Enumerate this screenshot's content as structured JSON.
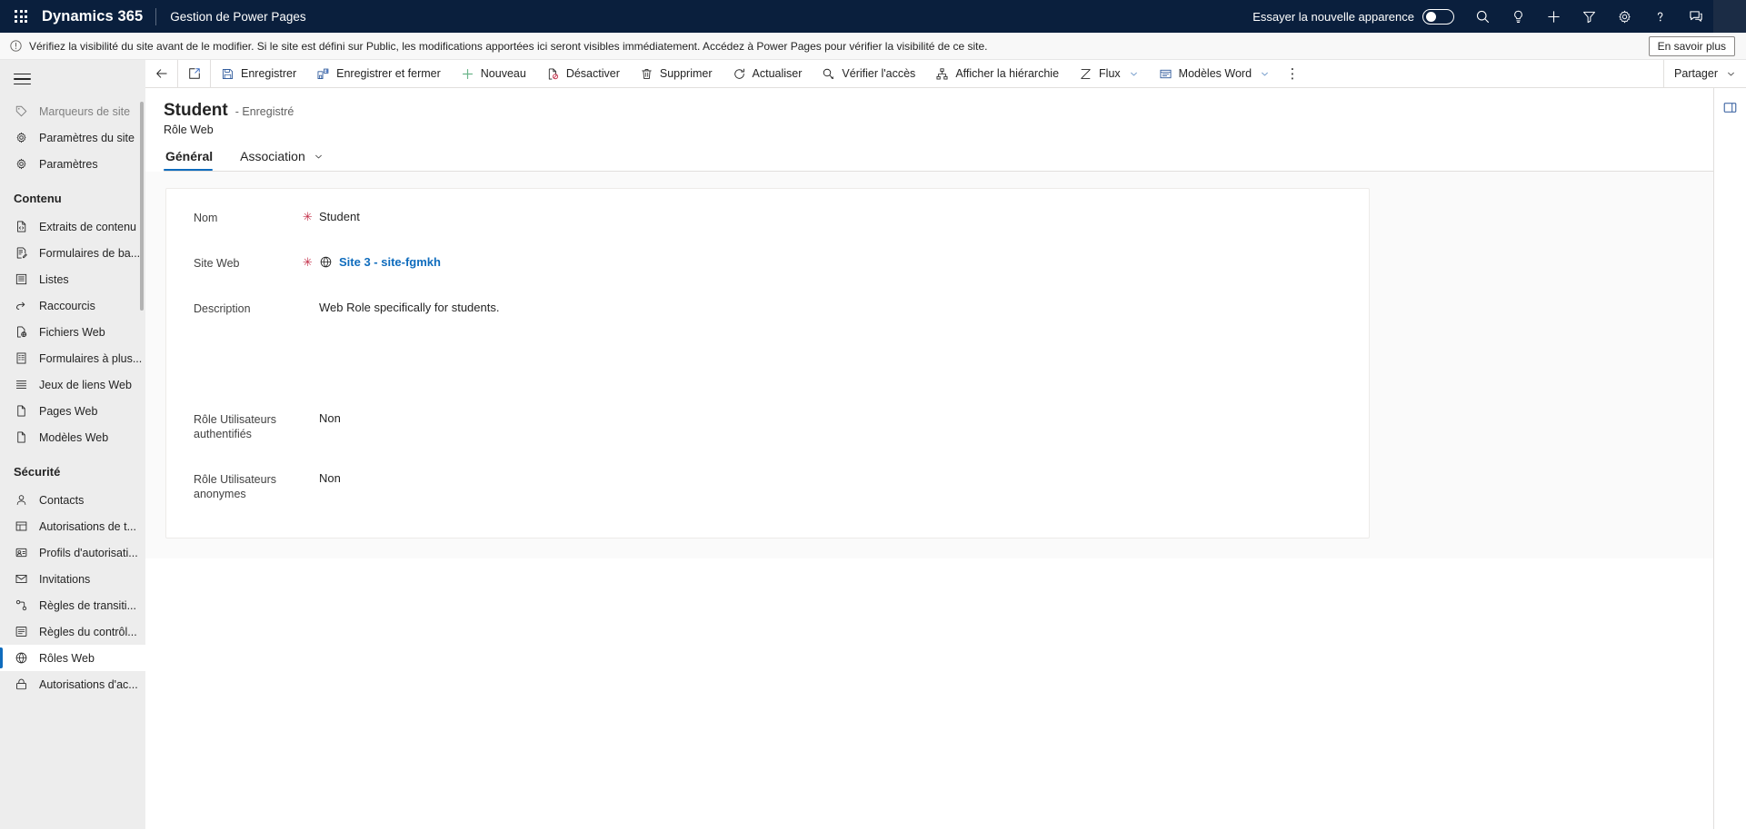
{
  "header": {
    "waffle_label": "waffle-icon",
    "brand": "Dynamics 365",
    "app_name": "Gestion de Power Pages",
    "new_look_label": "Essayer la nouvelle apparence",
    "new_look_enabled": false,
    "icons": [
      "search-icon",
      "lightbulb-icon",
      "plus-icon",
      "filter-icon",
      "gear-icon",
      "help-icon",
      "feedback-icon"
    ],
    "background": "#0a1f3d"
  },
  "banner": {
    "icon": "info-icon",
    "text": "Vérifiez la visibilité du site avant de le modifier. Si le site est défini sur Public, les modifications apportées ici seront visibles immédiatement. Accédez à Power Pages pour vérifier la visibilité de ce site.",
    "button_label": "En savoir plus"
  },
  "sidebar": {
    "hamburger": "hamburger-icon",
    "items_top": [
      {
        "label": "Marqueurs de site",
        "icon": "tag-icon",
        "partial": true
      },
      {
        "label": "Paramètres du site",
        "icon": "gear-site-icon"
      },
      {
        "label": "Paramètres",
        "icon": "gear-icon"
      }
    ],
    "groups": [
      {
        "title": "Contenu",
        "items": [
          {
            "label": "Extraits de contenu",
            "icon": "code-file-icon"
          },
          {
            "label": "Formulaires de ba...",
            "icon": "form-edit-icon"
          },
          {
            "label": "Listes",
            "icon": "list-icon"
          },
          {
            "label": "Raccourcis",
            "icon": "shortcut-icon"
          },
          {
            "label": "Fichiers Web",
            "icon": "web-file-icon"
          },
          {
            "label": "Formulaires à plus...",
            "icon": "multistep-form-icon"
          },
          {
            "label": "Jeux de liens Web",
            "icon": "weblink-set-icon"
          },
          {
            "label": "Pages Web",
            "icon": "web-page-icon"
          },
          {
            "label": "Modèles Web",
            "icon": "web-template-icon"
          }
        ]
      },
      {
        "title": "Sécurité",
        "items": [
          {
            "label": "Contacts",
            "icon": "contact-icon"
          },
          {
            "label": "Autorisations de t...",
            "icon": "table-permission-icon"
          },
          {
            "label": "Profils d'autorisati...",
            "icon": "permission-profile-icon"
          },
          {
            "label": "Invitations",
            "icon": "invitation-icon"
          },
          {
            "label": "Règles de transiti...",
            "icon": "transition-rule-icon"
          },
          {
            "label": "Règles du contrôl...",
            "icon": "control-rule-icon"
          },
          {
            "label": "Rôles Web",
            "icon": "web-role-icon",
            "selected": true
          },
          {
            "label": "Autorisations d'ac...",
            "icon": "access-permission-icon"
          }
        ]
      }
    ]
  },
  "commandbar": {
    "back": "back-arrow-icon",
    "popout": "popout-icon",
    "commands": [
      {
        "label": "Enregistrer",
        "icon": "save-icon"
      },
      {
        "label": "Enregistrer et fermer",
        "icon": "save-close-icon"
      },
      {
        "label": "Nouveau",
        "icon": "plus-icon"
      },
      {
        "label": "Désactiver",
        "icon": "deactivate-icon"
      },
      {
        "label": "Supprimer",
        "icon": "trash-icon"
      },
      {
        "label": "Actualiser",
        "icon": "refresh-icon"
      },
      {
        "label": "Vérifier l'accès",
        "icon": "check-access-icon"
      },
      {
        "label": "Afficher la hiérarchie",
        "icon": "hierarchy-icon"
      },
      {
        "label": "Flux",
        "icon": "flow-icon",
        "has_chevron": true
      },
      {
        "label": "Modèles Word",
        "icon": "word-template-icon",
        "has_chevron": true
      }
    ],
    "overflow": "⋮",
    "share_label": "Partager",
    "panel_icon": "side-panel-icon"
  },
  "record": {
    "title": "Student",
    "state": "- Enregistré",
    "subtitle": "Rôle Web"
  },
  "tabs": [
    {
      "label": "Général",
      "active": true
    },
    {
      "label": "Association",
      "active": false,
      "has_chevron": true
    }
  ],
  "form": {
    "fields": [
      {
        "label": "Nom",
        "required": true,
        "value": "Student",
        "type": "text"
      },
      {
        "label": "Site Web",
        "required": true,
        "value": "Site 3 - site-fgmkh",
        "type": "lookup",
        "icon": "globe-icon"
      },
      {
        "label": "Description",
        "required": false,
        "value": "Web Role specifically for students.",
        "type": "multiline"
      },
      {
        "label": "Rôle Utilisateurs authentifiés",
        "required": false,
        "value": "Non",
        "type": "text"
      },
      {
        "label": "Rôle Utilisateurs anonymes",
        "required": false,
        "value": "Non",
        "type": "text"
      }
    ]
  },
  "colors": {
    "header_bg": "#0a1f3d",
    "accent": "#0f6cbd",
    "required": "#c4314b",
    "sidebar_bg": "#ededed",
    "form_bg": "#fafafa"
  }
}
